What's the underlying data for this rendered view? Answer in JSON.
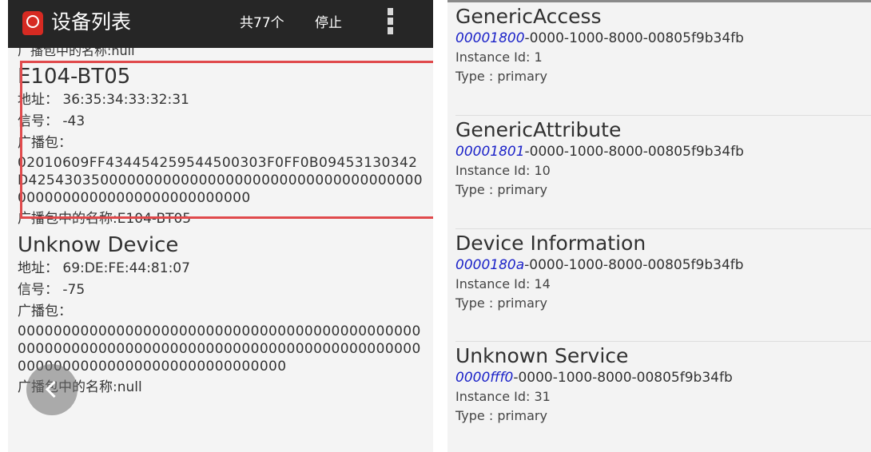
{
  "left_panel": {
    "app_title": "设备列表",
    "device_count": "共77个",
    "stop_label": "停止",
    "top_partial_text": "广播包中的名称:null",
    "devices": [
      {
        "name": "E104-BT05",
        "address_label": "地址：",
        "address": "36:35:34:33:32:31",
        "rssi_label": "信号：",
        "rssi": "-43",
        "adv_label": "广播包：",
        "adv_data": "02010609FF434454259544500303F0FF0B09453130342D4254303500000000000000000000000000000000000000000000000000000000000000",
        "adv_name": "广播包中的名称:E104-BT05"
      },
      {
        "name": "Unknow Device",
        "address_label": "地址：",
        "address": "69:DE:FE:44:81:07",
        "rssi_label": "信号：",
        "rssi": "-75",
        "adv_label": "广播包：",
        "adv_data": "000000000000000000000000000000000000000000000000000000000000000000000000000000000000000000000000000000000000000000000000",
        "adv_name": "广播包中的名称:null"
      }
    ]
  },
  "right_panel": {
    "services": [
      {
        "name": "GenericAccess",
        "uuid_short": "00001800",
        "uuid_rest": "-0000-1000-8000-00805f9b34fb",
        "instance": "Instance Id: 1",
        "type": "Type : primary"
      },
      {
        "name": "GenericAttribute",
        "uuid_short": "00001801",
        "uuid_rest": "-0000-1000-8000-00805f9b34fb",
        "instance": "Instance Id: 10",
        "type": "Type : primary"
      },
      {
        "name": "Device Information",
        "uuid_short": "0000180a",
        "uuid_rest": "-0000-1000-8000-00805f9b34fb",
        "instance": "Instance Id: 14",
        "type": "Type : primary"
      },
      {
        "name": "Unknown Service",
        "uuid_short": "0000fff0",
        "uuid_rest": "-0000-1000-8000-00805f9b34fb",
        "instance": "Instance Id: 31",
        "type": "Type : primary"
      }
    ]
  },
  "colors": {
    "action_bar": "#262626",
    "highlight_border": "#e04a4c",
    "uuid_link": "#1b22c8",
    "app_icon": "#d62a22"
  },
  "icons": [
    "app-icon",
    "overflow-menu-icon",
    "back-arrow-icon"
  ]
}
